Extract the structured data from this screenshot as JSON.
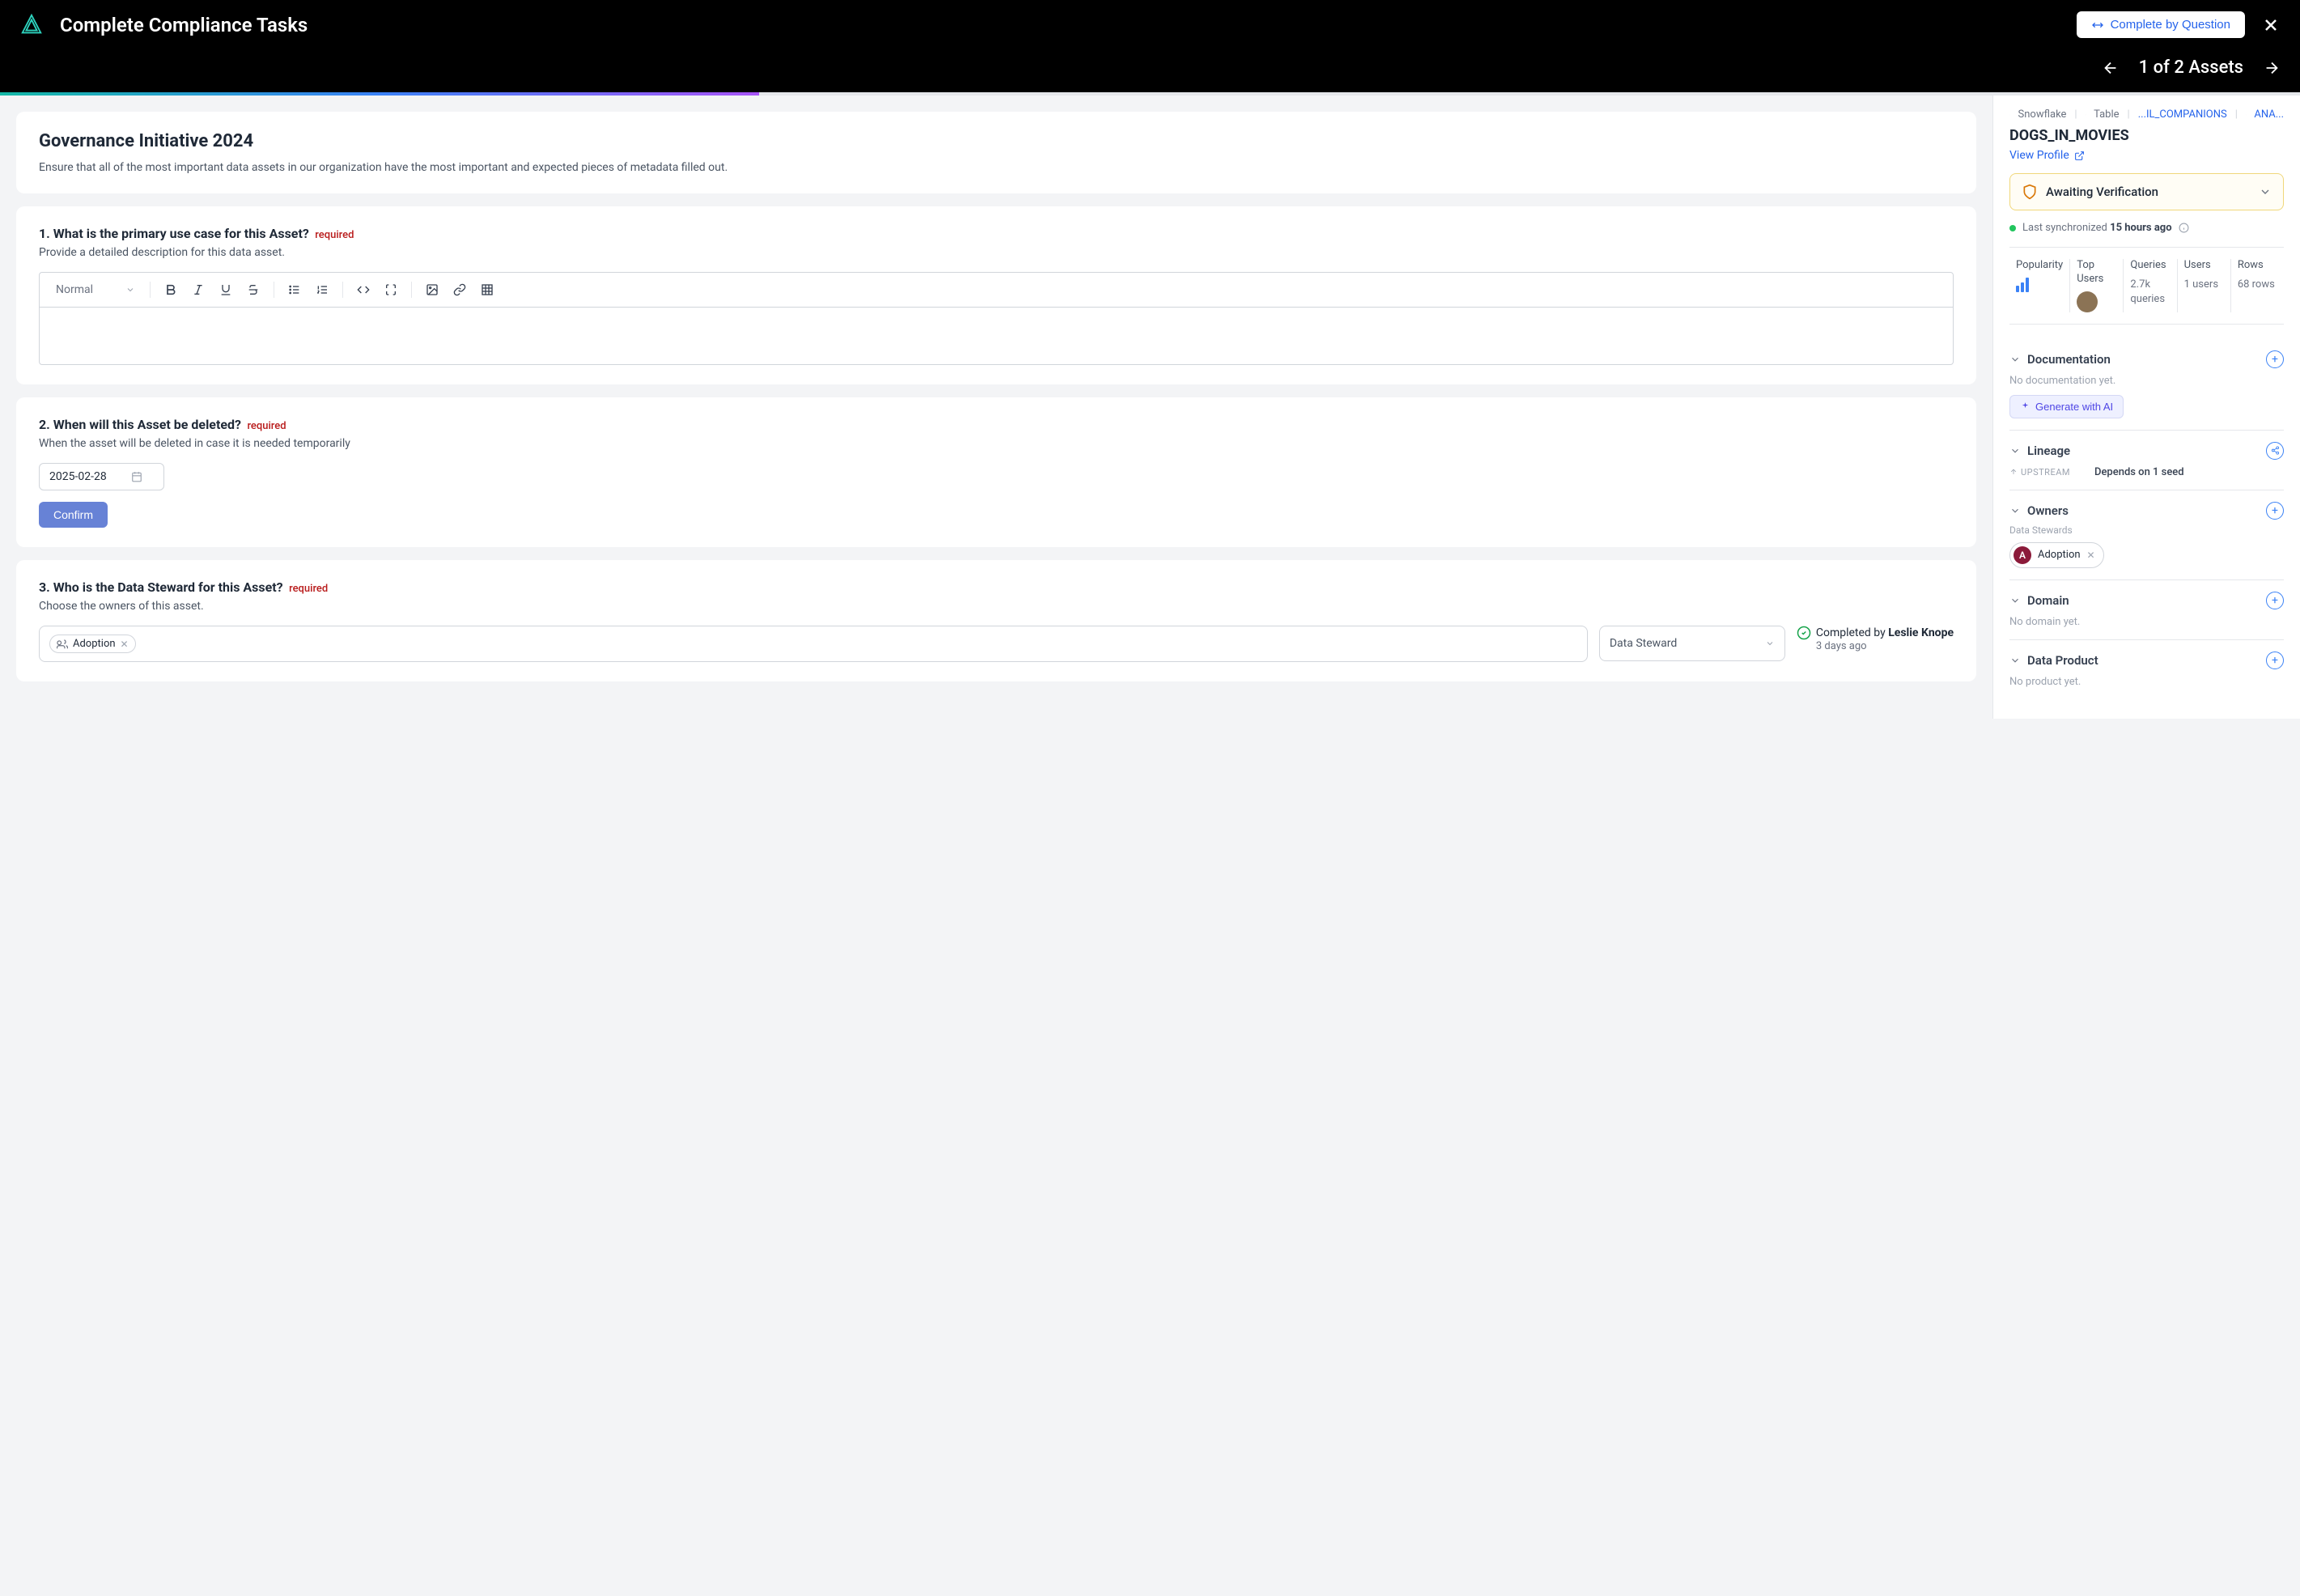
{
  "header": {
    "title": "Complete Compliance Tasks",
    "complete_by_question": "Complete by Question"
  },
  "subheader": {
    "counter": "1 of 2 Assets"
  },
  "intro": {
    "title": "Governance Initiative 2024",
    "desc": "Ensure that all of the most important data assets in our organization have the most important and expected pieces of metadata filled out."
  },
  "q1": {
    "title": "1. What is the primary use case for this Asset?",
    "required": "required",
    "desc": "Provide a detailed description for this data asset.",
    "format_label": "Normal"
  },
  "q2": {
    "title": "2. When will this Asset be deleted?",
    "required": "required",
    "desc": "When the asset will be deleted in case it is needed temporarily",
    "date": "2025-02-28",
    "confirm": "Confirm"
  },
  "q3": {
    "title": "3. Who is the Data Steward for this Asset?",
    "required": "required",
    "desc": "Choose the owners of this asset.",
    "tag": "Adoption",
    "role": "Data Steward",
    "completed_prefix": "Completed by ",
    "completed_name": "Leslie Knope",
    "completed_ago": "3 days ago"
  },
  "side": {
    "crumbs": {
      "source": "Snowflake",
      "type": "Table",
      "path1": "...IL_COMPANIONS",
      "path2": "ANA..."
    },
    "asset_name": "DOGS_IN_MOVIES",
    "view_profile": "View Profile",
    "verification": "Awaiting Verification",
    "sync_prefix": "Last synchronized ",
    "sync_time": "15 hours ago",
    "stats": {
      "popularity": "Popularity",
      "top_users": "Top Users",
      "queries_label": "Queries",
      "queries_val": "2.7k queries",
      "users_label": "Users",
      "users_val": "1 users",
      "rows_label": "Rows",
      "rows_val": "68 rows"
    },
    "documentation": {
      "title": "Documentation",
      "empty": "No documentation yet.",
      "generate": "Generate with AI"
    },
    "lineage": {
      "title": "Lineage",
      "upstream": "UPSTREAM",
      "depends": "Depends on 1 seed"
    },
    "owners": {
      "title": "Owners",
      "sub": "Data Stewards",
      "pill": "Adoption",
      "initial": "A"
    },
    "domain": {
      "title": "Domain",
      "empty": "No domain yet."
    },
    "data_product": {
      "title": "Data Product",
      "empty": "No product yet."
    }
  }
}
